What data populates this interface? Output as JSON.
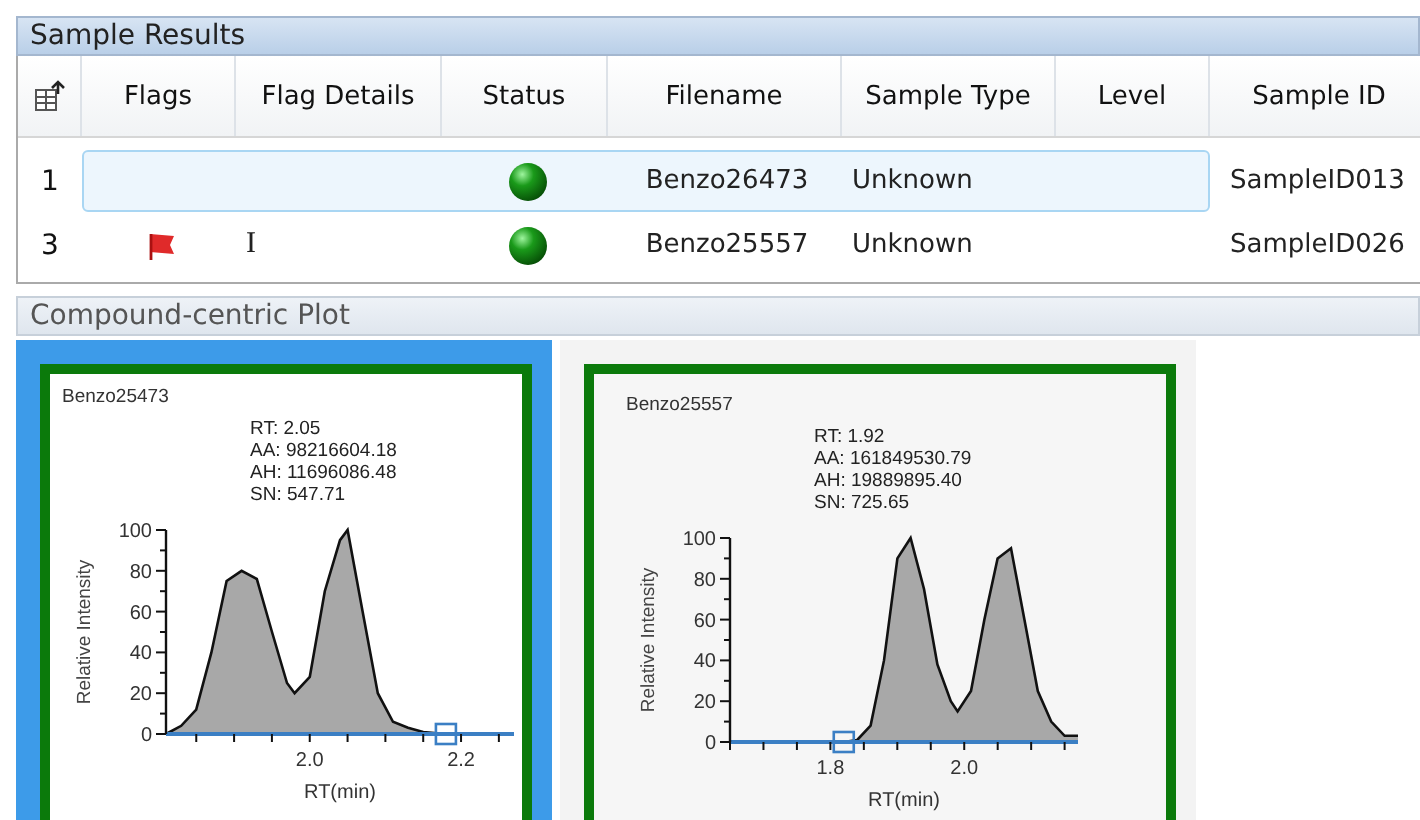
{
  "sample_results": {
    "title": "Sample Results",
    "columns": [
      "Flags",
      "Flag Details",
      "Status",
      "Filename",
      "Sample Type",
      "Level",
      "Sample ID"
    ],
    "rows": [
      {
        "number": "1",
        "selected": true,
        "flagged": false,
        "status_ok": true,
        "filename": "Benzo26473",
        "sample_type": "Unknown",
        "sample_id": "SampleID013"
      },
      {
        "number": "3",
        "selected": false,
        "flagged": true,
        "flag_details": "I",
        "status_ok": true,
        "filename": "Benzo25557",
        "sample_type": "Unknown",
        "sample_id": "SampleID026"
      }
    ]
  },
  "compound_plot": {
    "title": "Compound-centric Plot",
    "plots": [
      {
        "selected": true,
        "peak_info": [
          "RT: 2.05",
          "AA: 98216604.18",
          "AH: 11696086.48",
          "SN: 547.71"
        ],
        "chart_data": {
          "type": "area",
          "xlabel": "RT(min)",
          "ylabel": "Relative Intensity",
          "xlim": [
            1.81,
            2.27
          ],
          "ylim": [
            0,
            100
          ],
          "xticks": [
            {
              "value": 2.0,
              "label": "2.0"
            },
            {
              "value": 2.2,
              "label": "2.2"
            }
          ],
          "yticks": [
            0,
            20,
            40,
            60,
            80,
            100
          ],
          "x": [
            1.81,
            1.83,
            1.85,
            1.87,
            1.89,
            1.91,
            1.93,
            1.95,
            1.97,
            1.98,
            2.0,
            2.02,
            2.04,
            2.05,
            2.07,
            2.09,
            2.11,
            2.13,
            2.15,
            2.18,
            2.27
          ],
          "series": [
            {
              "name": "Benzo25473",
              "color": "#a8a8a8",
              "values": [
                0,
                4,
                12,
                40,
                75,
                80,
                76,
                50,
                25,
                20,
                28,
                70,
                95,
                100,
                60,
                20,
                6,
                3,
                1,
                0,
                0
              ]
            }
          ]
        }
      },
      {
        "selected": false,
        "peak_info": [
          "RT: 1.92",
          "AA: 161849530.79",
          "AH: 19889895.40",
          "SN: 725.65"
        ],
        "chart_data": {
          "type": "area",
          "xlabel": "RT(min)",
          "ylabel": "Relative Intensity",
          "xlim": [
            1.65,
            2.17
          ],
          "ylim": [
            0,
            100
          ],
          "xticks": [
            {
              "value": 1.8,
              "label": "1.8"
            },
            {
              "value": 2.0,
              "label": "2.0"
            }
          ],
          "yticks": [
            0,
            20,
            40,
            60,
            80,
            100
          ],
          "x": [
            1.65,
            1.7,
            1.75,
            1.8,
            1.82,
            1.84,
            1.86,
            1.88,
            1.9,
            1.92,
            1.94,
            1.96,
            1.98,
            1.99,
            2.01,
            2.03,
            2.05,
            2.07,
            2.09,
            2.11,
            2.13,
            2.15,
            2.17
          ],
          "series": [
            {
              "name": "Benzo25557",
              "color": "#a8a8a8",
              "values": [
                0,
                0,
                0,
                0,
                0,
                1,
                8,
                40,
                90,
                100,
                75,
                38,
                20,
                15,
                25,
                60,
                90,
                95,
                60,
                25,
                10,
                3,
                3
              ]
            }
          ]
        }
      }
    ]
  }
}
